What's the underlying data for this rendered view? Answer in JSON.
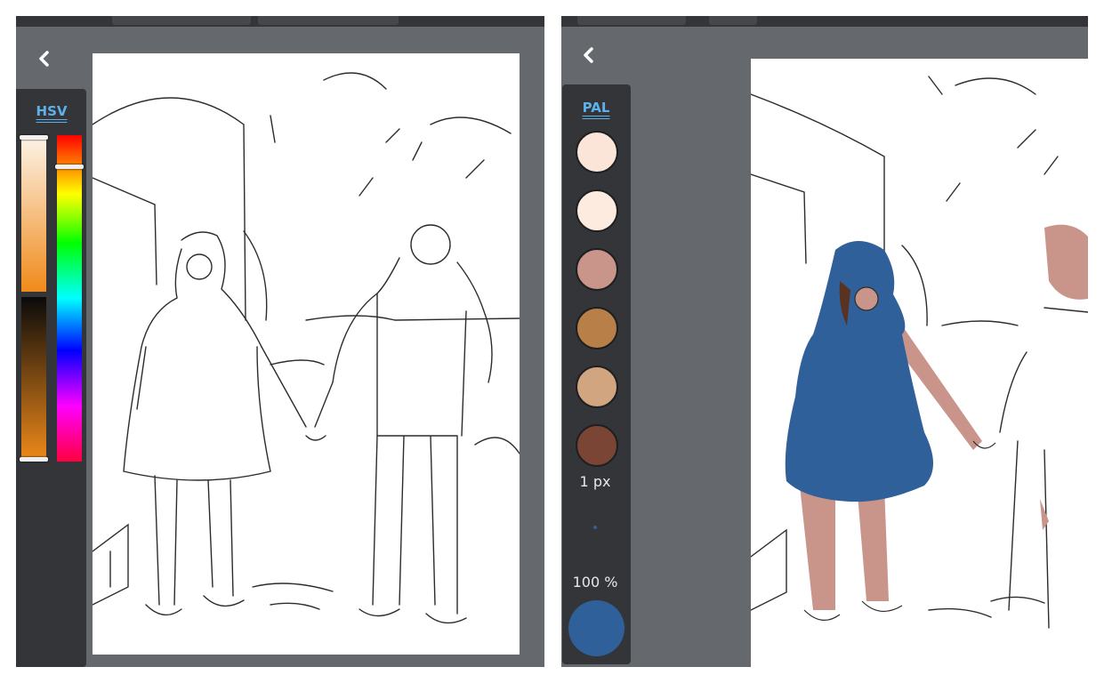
{
  "left": {
    "color_mode_label": "HSV",
    "saturation_level": 1.0,
    "value_level": 1.0,
    "hue_level": 0.09,
    "selected_color": "#f08a1a"
  },
  "right": {
    "palette_label": "PAL",
    "swatches": [
      {
        "name": "peach-light",
        "color": "#fbe4d8"
      },
      {
        "name": "cream",
        "color": "#fdebe0"
      },
      {
        "name": "rose-tan",
        "color": "#c9958a"
      },
      {
        "name": "caramel",
        "color": "#b87f48"
      },
      {
        "name": "sand",
        "color": "#d2a581"
      },
      {
        "name": "brown",
        "color": "#7a4534"
      }
    ],
    "brush_size_label": "1 px",
    "opacity_label": "100 %",
    "current_color": "#30609a"
  },
  "icons": {
    "back": "chevron-left-icon"
  }
}
